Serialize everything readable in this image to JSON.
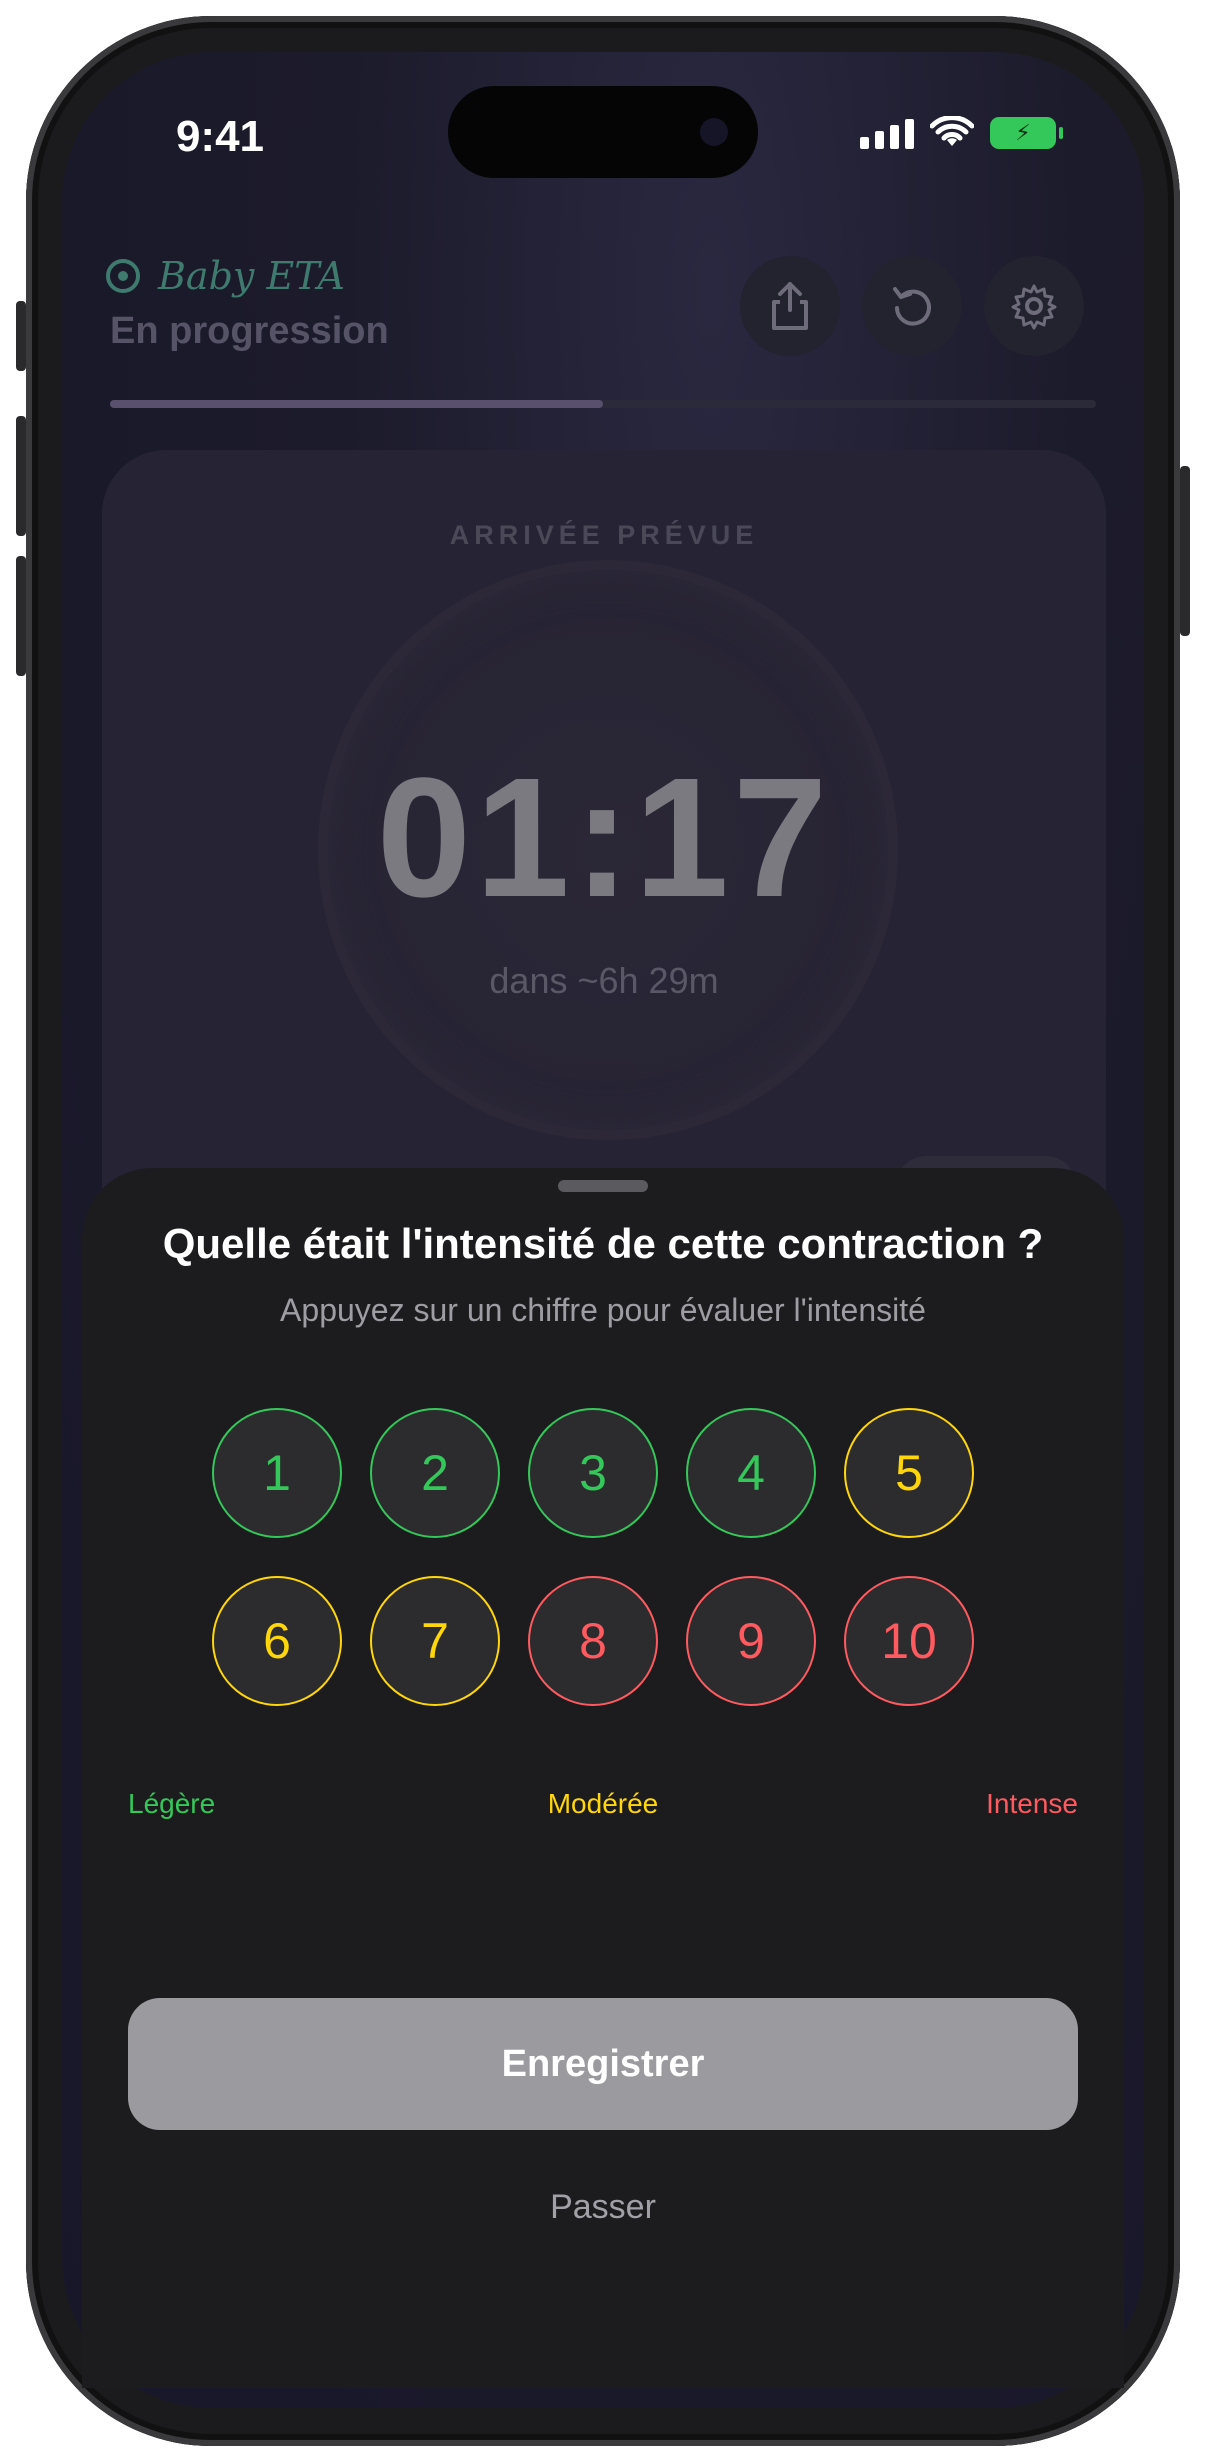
{
  "status_bar": {
    "time": "9:41"
  },
  "header": {
    "brand": "Baby ETA",
    "subtitle": "En progression",
    "progress": 0.5
  },
  "card": {
    "title": "ARRIVÉE PRÉVUE",
    "eta_time": "01:17",
    "eta_subtitle": "dans ~6h 29m"
  },
  "sheet": {
    "title": "Quelle était l'intensité de cette contraction ?",
    "subtitle": "Appuyez sur un chiffre pour évaluer l'intensité",
    "ratings": [
      "1",
      "2",
      "3",
      "4",
      "5",
      "6",
      "7",
      "8",
      "9",
      "10"
    ],
    "legend": {
      "light": "Légère",
      "moderate": "Modérée",
      "intense": "Intense"
    },
    "save_label": "Enregistrer",
    "skip_label": "Passer"
  },
  "colors": {
    "light": "#34c759",
    "moderate": "#ffd60a",
    "intense": "#ff5a5f",
    "brand": "#3f7a6f"
  },
  "icons": [
    "share-icon",
    "reset-icon",
    "gear-icon"
  ]
}
